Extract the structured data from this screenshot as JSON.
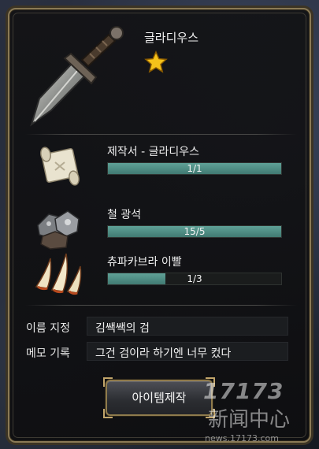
{
  "item": {
    "name": "글라디우스",
    "rarity": "1-star",
    "icon": "sword-icon"
  },
  "materials": [
    {
      "name": "제작서 - 글라디우스",
      "count": "1/1",
      "progress": 1.0,
      "icon": "scroll-icon"
    },
    {
      "name": "철 광석",
      "count": "15/5",
      "progress": 1.0,
      "icon": "iron-ore-icon"
    },
    {
      "name": "츄파카브라 이빨",
      "count": "1/3",
      "progress": 0.333,
      "icon": "tooth-icon"
    }
  ],
  "fields": {
    "name_label": "이름 지정",
    "name_value": "김쌕쌕의 검",
    "memo_label": "메모 기록",
    "memo_value": "그건 검이라 하기엔 너무 컸다"
  },
  "action": {
    "craft_label": "아이템제작"
  },
  "colors": {
    "bar_fill": "#5fa197",
    "frame_gold": "#8a7a56",
    "star": "#f5c21a"
  },
  "watermark": {
    "logo": "17173",
    "text": "新闻中心",
    "url": "news.17173.com"
  }
}
